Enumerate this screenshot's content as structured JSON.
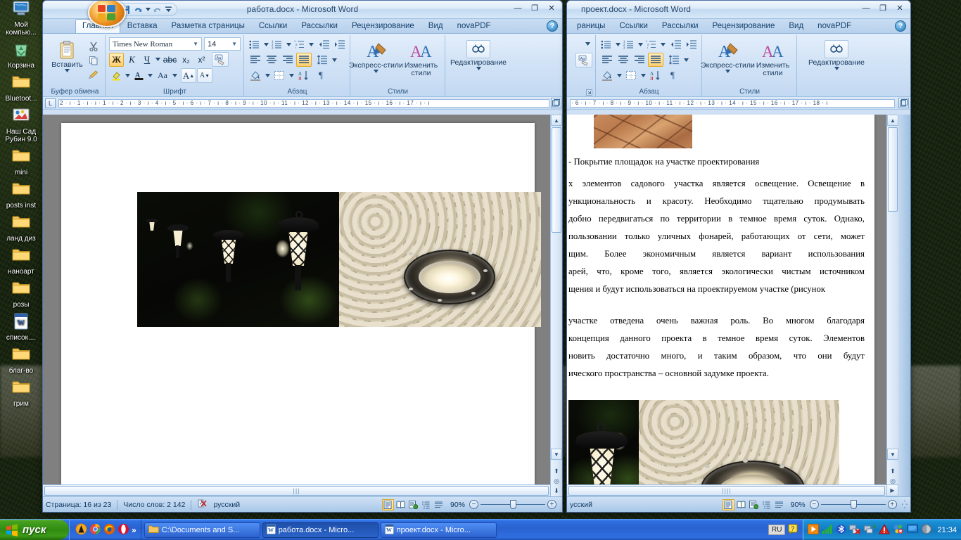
{
  "desktop": {
    "icons": [
      {
        "name": "my-computer",
        "label": "Мой компью...",
        "type": "computer"
      },
      {
        "name": "recycle-bin",
        "label": "Корзина",
        "type": "recycle"
      },
      {
        "name": "bluetooth-folder",
        "label": "Bluetoot...",
        "type": "folder"
      },
      {
        "name": "nash-sad-rubin",
        "label": "Наш Сад Рубин 9.0",
        "type": "app"
      },
      {
        "name": "mini-folder",
        "label": "mini",
        "type": "folder"
      },
      {
        "name": "posts-inst-folder",
        "label": "posts inst",
        "type": "folder"
      },
      {
        "name": "land-diz-folder",
        "label": "ланд диз",
        "type": "folder"
      },
      {
        "name": "nanoart-folder",
        "label": "наноарт",
        "type": "folder"
      },
      {
        "name": "rozy-folder",
        "label": "розы",
        "type": "folder"
      },
      {
        "name": "spisok-doc",
        "label": "список....",
        "type": "word"
      },
      {
        "name": "blag-vo-folder",
        "label": "благ-во",
        "type": "folder"
      },
      {
        "name": "grim-folder",
        "label": "грим",
        "type": "folder"
      }
    ]
  },
  "window_left": {
    "title": "работа.docx - Microsoft Word",
    "min_label": "—",
    "max_label": "❐",
    "close_label": "✕",
    "quick_access": [
      "save-icon",
      "undo-icon",
      "redo-icon",
      "customize-qat-icon"
    ],
    "tabs": [
      {
        "name": "home",
        "label": "Главная",
        "active": true
      },
      {
        "name": "insert",
        "label": "Вставка",
        "active": false
      },
      {
        "name": "page-layout",
        "label": "Разметка страницы",
        "active": false
      },
      {
        "name": "references",
        "label": "Ссылки",
        "active": false
      },
      {
        "name": "mailings",
        "label": "Рассылки",
        "active": false
      },
      {
        "name": "review",
        "label": "Рецензирование",
        "active": false
      },
      {
        "name": "view",
        "label": "Вид",
        "active": false
      },
      {
        "name": "novapdf",
        "label": "novaPDF",
        "active": false
      }
    ],
    "groups": {
      "clipboard": {
        "label": "Буфер обмена",
        "paste": "Вставить"
      },
      "font": {
        "label": "Шрифт",
        "family": "Times New Roman",
        "size": "14",
        "bold": "Ж",
        "italic": "К",
        "underline": "Ч",
        "strike": "abc",
        "sub": "x₂",
        "sup": "x²"
      },
      "paragraph": {
        "label": "Абзац"
      },
      "styles": {
        "label": "Стили",
        "quick": "Экспресс-стили",
        "change": "Изменить стили"
      },
      "editing": {
        "label": "Редактирование"
      }
    },
    "ruler": "2 · ı · 1 · ı · ı · 1 · ı · 2 · ı · 3 · ı · 4 · ı · 5 · ı · 6 · ı · 7 · ı · 8 · ı · 9 · ı · 10 · ı · 11 · ı · 12 · ı · 13 · ı · 14 · ı · 15 · ı · 16 · ı · 17 · ı · ı",
    "status": {
      "page": "Страница: 16 из 23",
      "words": "Число слов: 2 142",
      "language": "русский",
      "zoom": "90%"
    }
  },
  "window_right": {
    "title": "проект.docx - Microsoft Word",
    "min_label": "—",
    "max_label": "❐",
    "close_label": "✕",
    "tabs": [
      {
        "name": "page-layout",
        "label": "раницы",
        "active": false
      },
      {
        "name": "references",
        "label": "Ссылки",
        "active": false
      },
      {
        "name": "mailings",
        "label": "Рассылки",
        "active": false
      },
      {
        "name": "review",
        "label": "Рецензирование",
        "active": false
      },
      {
        "name": "view",
        "label": "Вид",
        "active": false
      },
      {
        "name": "novapdf",
        "label": "novaPDF",
        "active": false
      }
    ],
    "groups": {
      "paragraph": {
        "label": "Абзац"
      },
      "styles": {
        "label": "Стили",
        "quick": "Экспресс-стили",
        "change": "Изменить стили"
      },
      "editing": {
        "label": "Редактирование"
      }
    },
    "ruler": "· 6 · ı · 7 · ı · 8 · ı · 9 · ı · 10 · ı · 11 · ı · 12 · ı · 13 · ı · 14 · ı · 15 · ı · 16 · ı · 17 · ı · 18 · ı",
    "document": {
      "caption": "- Покрытие площадок на участке проектирования",
      "paragraph1": [
        "х элементов садового участка является освещение. Освещение в",
        "ункциональность и красоту. Необходимо тщательно продумывать",
        "добно передвигаться по территории в темное время суток. Однако,",
        "пользовании только уличных фонарей, работающих от сети, может",
        "щим. Более экономичным является вариант использования",
        "арей, что, кроме того, является экологически чистым источником",
        "щения и будут использоваться на проектируемом участке (рисунок"
      ],
      "paragraph2": [
        "участке отведена очень важная роль. Во многом благодаря",
        "концепция данного проекта в темное время суток. Элементов",
        "новить достаточно много, и таким образом, что они будут",
        "ического пространства – основной задумке проекта."
      ]
    },
    "status": {
      "language": "усский",
      "zoom": "90%"
    }
  },
  "taskbar": {
    "start": "пуск",
    "quick_launch": [
      "avast-icon",
      "chrome-icon",
      "firefox-icon",
      "opera-icon"
    ],
    "quick_launch_overflow": "»",
    "buttons": [
      {
        "name": "explorer",
        "label": "C:\\Documents and S...",
        "icon": "folder-icon",
        "active": false
      },
      {
        "name": "word-rabota",
        "label": "работа.docx - Micro...",
        "icon": "word-icon",
        "active": true
      },
      {
        "name": "word-proekt",
        "label": "проект.docx - Micro...",
        "icon": "word-icon",
        "active": false
      }
    ],
    "language": "RU",
    "tray_icons": [
      "media-player-icon",
      "signal-icon",
      "bluetooth-icon",
      "network-disconnected-icon",
      "network-icon",
      "warning-icon",
      "antivirus-icon",
      "monitor-icon",
      "shield-icon"
    ],
    "clock": "21:34"
  }
}
